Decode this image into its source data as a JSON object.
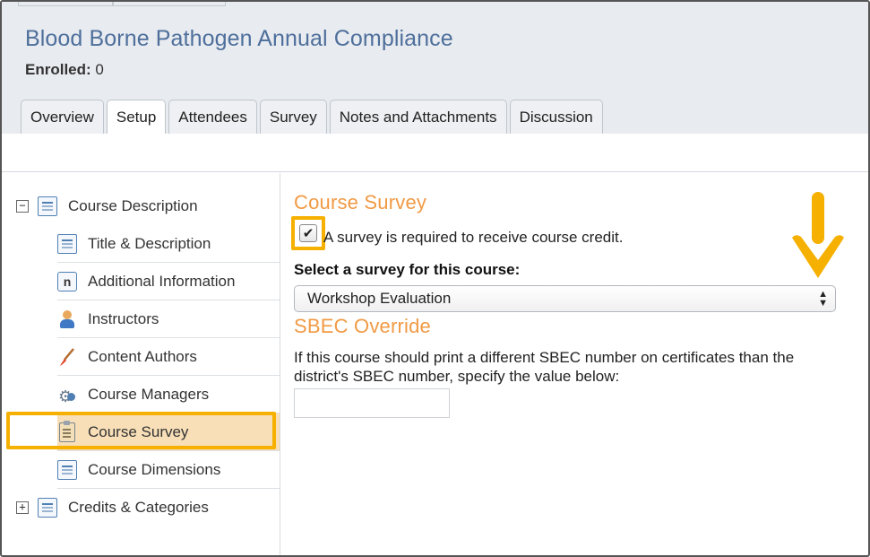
{
  "header": {
    "title": "Blood Borne Pathogen Annual Compliance",
    "enrolled_label": "Enrolled:",
    "enrolled_value": "0"
  },
  "tabs": [
    {
      "label": "Overview",
      "active": false
    },
    {
      "label": "Setup",
      "active": true
    },
    {
      "label": "Attendees",
      "active": false
    },
    {
      "label": "Survey",
      "active": false
    },
    {
      "label": "Notes and Attachments",
      "active": false
    },
    {
      "label": "Discussion",
      "active": false
    }
  ],
  "tree": {
    "course_description": {
      "label": "Course Description",
      "expander": "−"
    },
    "items": [
      {
        "label": "Title & Description",
        "icon": "document-icon"
      },
      {
        "label": "Additional Information",
        "icon": "n-icon"
      },
      {
        "label": "Instructors",
        "icon": "person-icon"
      },
      {
        "label": "Content Authors",
        "icon": "paintbrush-icon"
      },
      {
        "label": "Course Managers",
        "icon": "gear-person-icon"
      },
      {
        "label": "Course Survey",
        "icon": "clipboard-icon",
        "selected": true
      },
      {
        "label": "Course Dimensions",
        "icon": "document-icon"
      }
    ],
    "credits_categories": {
      "label": "Credits & Categories",
      "expander": "+"
    }
  },
  "content": {
    "survey_title": "Course Survey",
    "checkbox_checked": true,
    "checkbox_mark": "✔",
    "checkbox_label": "A survey is required to receive course credit.",
    "select_label": "Select a survey for this course:",
    "select_value": "Workshop Evaluation",
    "sbec_title": "SBEC Override",
    "sbec_text": "If this course should print a different SBEC number on certificates than the district's SBEC number, specify the value below:",
    "sbec_value": ""
  },
  "colors": {
    "title_blue": "#4e6f9c",
    "section_orange": "#f19a45",
    "highlight_gold": "#f5b000",
    "selected_row": "#f8dfb8"
  }
}
